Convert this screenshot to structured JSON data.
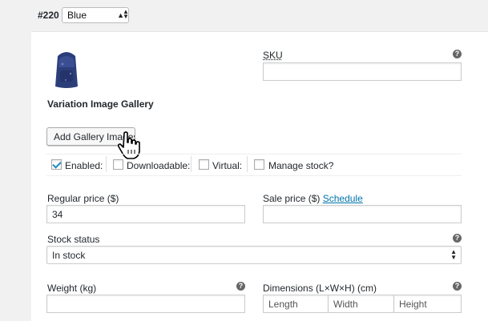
{
  "variation": {
    "number": "#220",
    "attribute_value": "Blue"
  },
  "image_section": {
    "gallery_title": "Variation Image Gallery",
    "add_gallery_button": "Add Gallery Images"
  },
  "sku": {
    "label": "SKU",
    "value": ""
  },
  "options": {
    "enabled": {
      "label": "Enabled:",
      "checked": true
    },
    "downloadable": {
      "label": "Downloadable:",
      "checked": false
    },
    "virtual": {
      "label": "Virtual:",
      "checked": false
    },
    "manage_stock": {
      "label": "Manage stock?",
      "checked": false
    }
  },
  "pricing": {
    "regular_label": "Regular price ($)",
    "regular_value": "34",
    "sale_label": "Sale price ($)",
    "schedule_link": "Schedule",
    "sale_value": ""
  },
  "stock": {
    "label": "Stock status",
    "value": "In stock"
  },
  "shipping": {
    "weight_label": "Weight (kg)",
    "weight_value": "",
    "dimensions_label": "Dimensions (L×W×H) (cm)",
    "length_placeholder": "Length",
    "width_placeholder": "Width",
    "height_placeholder": "Height"
  },
  "icons": {
    "help": "?",
    "select_arrow": "⬍"
  },
  "colors": {
    "link": "#0073aa",
    "checkbox_check": "#1e8cbe",
    "panel_bg": "#ffffff",
    "page_bg": "#f1f1f1"
  }
}
